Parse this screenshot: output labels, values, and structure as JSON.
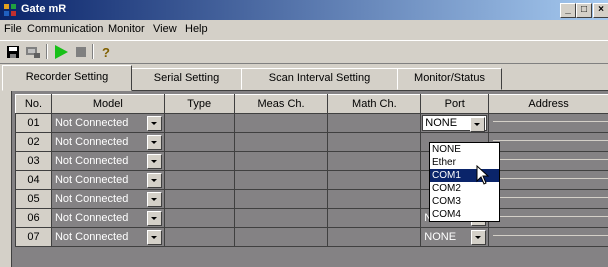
{
  "window": {
    "title": "Gate mR"
  },
  "menu": [
    "File",
    "Communication",
    "Monitor",
    "View",
    "Help"
  ],
  "toolbar": {
    "buttons": [
      "save-icon",
      "settings-icon",
      "play-icon",
      "stop-icon",
      "help-icon"
    ],
    "help_glyph": "?"
  },
  "tabs": [
    "Recorder Setting",
    "Serial Setting",
    "Scan Interval Setting",
    "Monitor/Status"
  ],
  "active_tab": "Recorder Setting",
  "columns": [
    "No.",
    "Model",
    "Type",
    "Meas Ch.",
    "Math Ch.",
    "Port",
    "Address"
  ],
  "rows": [
    {
      "no": "01",
      "model": "Not Connected",
      "port": "NONE"
    },
    {
      "no": "02",
      "model": "Not Connected",
      "port": ""
    },
    {
      "no": "03",
      "model": "Not Connected",
      "port": ""
    },
    {
      "no": "04",
      "model": "Not Connected",
      "port": ""
    },
    {
      "no": "05",
      "model": "Not Connected",
      "port": ""
    },
    {
      "no": "06",
      "model": "Not Connected",
      "port": "NONE"
    },
    {
      "no": "07",
      "model": "Not Connected",
      "port": "NONE"
    }
  ],
  "port_dropdown": {
    "options": [
      "NONE",
      "Ether",
      "COM1",
      "COM2",
      "COM3",
      "COM4"
    ],
    "highlighted": "COM1"
  },
  "colors": {
    "title_start": "#0a246a",
    "title_end": "#a6caf0",
    "grid_bg": "#848284",
    "selection": "#0a246a"
  }
}
